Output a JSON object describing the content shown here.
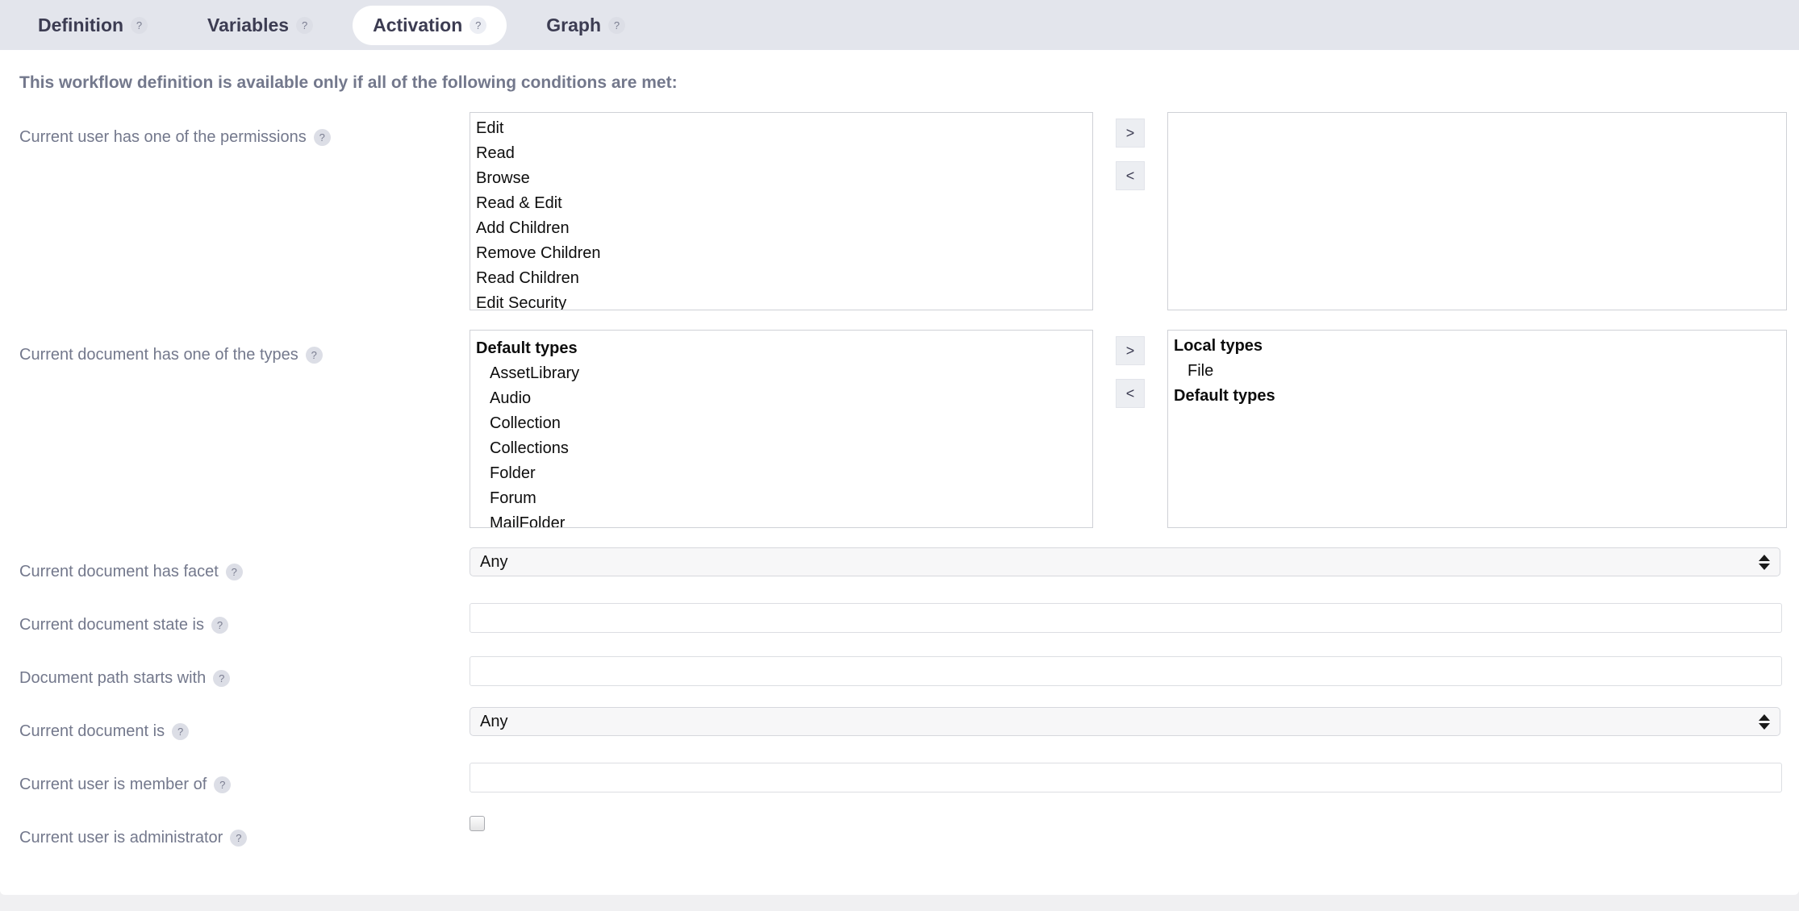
{
  "tabs": [
    {
      "label": "Definition",
      "help": "?",
      "active": false
    },
    {
      "label": "Variables",
      "help": "?",
      "active": false
    },
    {
      "label": "Activation",
      "help": "?",
      "active": true
    },
    {
      "label": "Graph",
      "help": "?",
      "active": false
    }
  ],
  "panel": {
    "title": "This workflow definition is available only if all of the following conditions are met:"
  },
  "transfer": {
    "add": ">",
    "remove": "<"
  },
  "rows": {
    "permissions": {
      "label": "Current user has one of the permissions",
      "help": "?",
      "available": [
        "Edit",
        "Read",
        "Browse",
        "Read & Edit",
        "Add Children",
        "Remove Children",
        "Read Children",
        "Edit Security"
      ],
      "selected": []
    },
    "types": {
      "label": "Current document has one of the types",
      "help": "?",
      "available": [
        {
          "text": "Default types",
          "group": true
        },
        {
          "text": "AssetLibrary",
          "group": false
        },
        {
          "text": "Audio",
          "group": false
        },
        {
          "text": "Collection",
          "group": false
        },
        {
          "text": "Collections",
          "group": false
        },
        {
          "text": "Folder",
          "group": false
        },
        {
          "text": "Forum",
          "group": false
        },
        {
          "text": "MailFolder",
          "group": false
        }
      ],
      "selected": [
        {
          "text": "Local types",
          "group": true
        },
        {
          "text": "File",
          "group": false
        },
        {
          "text": "Default types",
          "group": true
        }
      ]
    },
    "facet": {
      "label": "Current document has facet",
      "help": "?",
      "value": "Any"
    },
    "state": {
      "label": "Current document state is",
      "help": "?",
      "value": "",
      "placeholder": ""
    },
    "path": {
      "label": "Document path starts with",
      "help": "?",
      "value": "",
      "placeholder": ""
    },
    "document_is": {
      "label": "Current document is",
      "help": "?",
      "value": "Any"
    },
    "member_of": {
      "label": "Current user is member of",
      "help": "?",
      "value": "",
      "placeholder": ""
    },
    "administrator": {
      "label": "Current user is administrator",
      "help": "?",
      "checked": false
    }
  }
}
